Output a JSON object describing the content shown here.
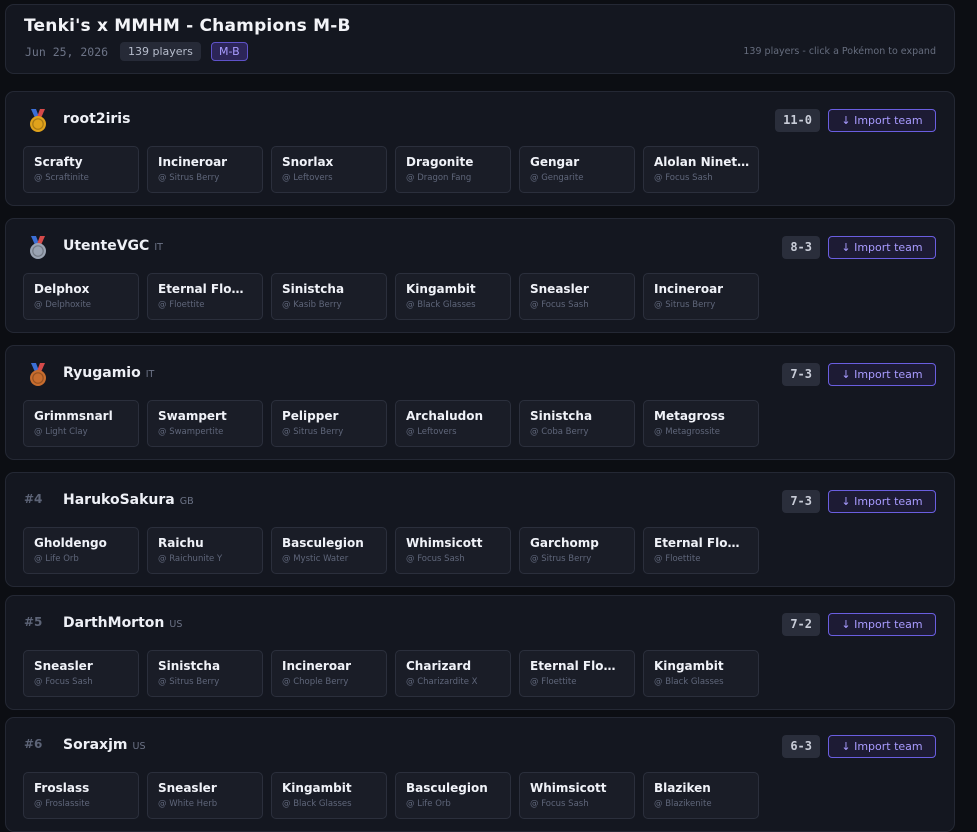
{
  "header": {
    "title": "Tenki's x MMHM - Champions M-B",
    "date": "Jun 25, 2026",
    "players_chip": "139 players",
    "format_chip": "M-B",
    "hint": "139 players - click a Pokémon to expand"
  },
  "import_label": "↓ Import team",
  "colors": {
    "gold": "#e0a21b",
    "silver": "#9aa3b2",
    "bronze": "#c86d2e",
    "accent": "#6a5ee0"
  },
  "players": [
    {
      "rank": "#1",
      "medal": "gold-medal-icon",
      "name": "root2iris",
      "country": "",
      "record": "11-0",
      "team": [
        {
          "name": "Scrafty",
          "item": "@ Scraftinite"
        },
        {
          "name": "Incineroar",
          "item": "@ Sitrus Berry"
        },
        {
          "name": "Snorlax",
          "item": "@ Leftovers"
        },
        {
          "name": "Dragonite",
          "item": "@ Dragon Fang"
        },
        {
          "name": "Gengar",
          "item": "@ Gengarite"
        },
        {
          "name": "Alolan Ninet…",
          "item": "@ Focus Sash"
        }
      ]
    },
    {
      "rank": "#2",
      "medal": "silver-medal-icon",
      "name": "UtenteVGC",
      "country": "IT",
      "record": "8-3",
      "team": [
        {
          "name": "Delphox",
          "item": "@ Delphoxite"
        },
        {
          "name": "Eternal Flow…",
          "item": "@ Floettite"
        },
        {
          "name": "Sinistcha",
          "item": "@ Kasib Berry"
        },
        {
          "name": "Kingambit",
          "item": "@ Black Glasses"
        },
        {
          "name": "Sneasler",
          "item": "@ Focus Sash"
        },
        {
          "name": "Incineroar",
          "item": "@ Sitrus Berry"
        }
      ]
    },
    {
      "rank": "#3",
      "medal": "bronze-medal-icon",
      "name": "Ryugamio",
      "country": "IT",
      "record": "7-3",
      "team": [
        {
          "name": "Grimmsnarl",
          "item": "@ Light Clay"
        },
        {
          "name": "Swampert",
          "item": "@ Swampertite"
        },
        {
          "name": "Pelipper",
          "item": "@ Sitrus Berry"
        },
        {
          "name": "Archaludon",
          "item": "@ Leftovers"
        },
        {
          "name": "Sinistcha",
          "item": "@ Coba Berry"
        },
        {
          "name": "Metagross",
          "item": "@ Metagrossite"
        }
      ]
    },
    {
      "rank": "#4",
      "medal": "",
      "name": "HarukoSakura",
      "country": "GB",
      "record": "7-3",
      "team": [
        {
          "name": "Gholdengo",
          "item": "@ Life Orb"
        },
        {
          "name": "Raichu",
          "item": "@ Raichunite Y"
        },
        {
          "name": "Basculegion",
          "item": "@ Mystic Water"
        },
        {
          "name": "Whimsicott",
          "item": "@ Focus Sash"
        },
        {
          "name": "Garchomp",
          "item": "@ Sitrus Berry"
        },
        {
          "name": "Eternal Flow…",
          "item": "@ Floettite"
        }
      ]
    },
    {
      "rank": "#5",
      "medal": "",
      "name": "DarthMorton",
      "country": "US",
      "record": "7-2",
      "team": [
        {
          "name": "Sneasler",
          "item": "@ Focus Sash"
        },
        {
          "name": "Sinistcha",
          "item": "@ Sitrus Berry"
        },
        {
          "name": "Incineroar",
          "item": "@ Chople Berry"
        },
        {
          "name": "Charizard",
          "item": "@ Charizardite X"
        },
        {
          "name": "Eternal Flow…",
          "item": "@ Floettite"
        },
        {
          "name": "Kingambit",
          "item": "@ Black Glasses"
        }
      ]
    },
    {
      "rank": "#6",
      "medal": "",
      "name": "Soraxjm",
      "country": "US",
      "record": "6-3",
      "team": [
        {
          "name": "Froslass",
          "item": "@ Froslassite"
        },
        {
          "name": "Sneasler",
          "item": "@ White Herb"
        },
        {
          "name": "Kingambit",
          "item": "@ Black Glasses"
        },
        {
          "name": "Basculegion",
          "item": "@ Life Orb"
        },
        {
          "name": "Whimsicott",
          "item": "@ Focus Sash"
        },
        {
          "name": "Blaziken",
          "item": "@ Blazikenite"
        }
      ]
    }
  ]
}
